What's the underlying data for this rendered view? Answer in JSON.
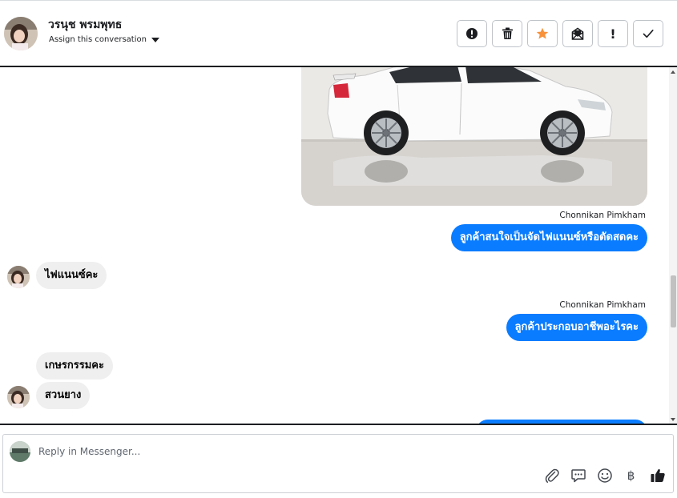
{
  "header": {
    "contact_name": "วรนุช พรมพุทธ",
    "assign_label": "Assign this conversation",
    "toolbar": [
      {
        "name": "mark-spam-button",
        "icon": "alert-circle-icon"
      },
      {
        "name": "delete-button",
        "icon": "trash-icon"
      },
      {
        "name": "star-button",
        "icon": "star-icon",
        "color": "#f7923b"
      },
      {
        "name": "mark-unread-button",
        "icon": "envelope-open-icon"
      },
      {
        "name": "follow-up-button",
        "icon": "exclamation-icon",
        "label": "!"
      },
      {
        "name": "mark-done-button",
        "icon": "check-icon"
      }
    ]
  },
  "messages": {
    "image": {
      "subject": "white sedan car photo"
    },
    "outgoing_1": {
      "sender": "Chonnikan Pimkham",
      "text": "ลูกค้าสนใจเป็นจัดไฟแนนซ์หรือตัดสดคะ"
    },
    "incoming_1": {
      "text": "ไฟแนนซ์คะ"
    },
    "outgoing_2": {
      "sender": "Chonnikan Pimkham",
      "text": "ลูกค้าประกอบอาชีพอะไรคะ"
    },
    "incoming_2": {
      "text": "เกษรกรรมคะ"
    },
    "incoming_3": {
      "text": "สวนยาง"
    }
  },
  "composer": {
    "placeholder": "Reply in Messenger...",
    "icons": [
      "paperclip-icon",
      "saved-reply-icon",
      "emoji-icon",
      "baht-icon",
      "thumbs-up-icon"
    ],
    "baht_symbol": "฿"
  },
  "colors": {
    "outgoing_bubble": "#0a7cff",
    "incoming_bubble": "#efefef",
    "star": "#f7923b"
  }
}
